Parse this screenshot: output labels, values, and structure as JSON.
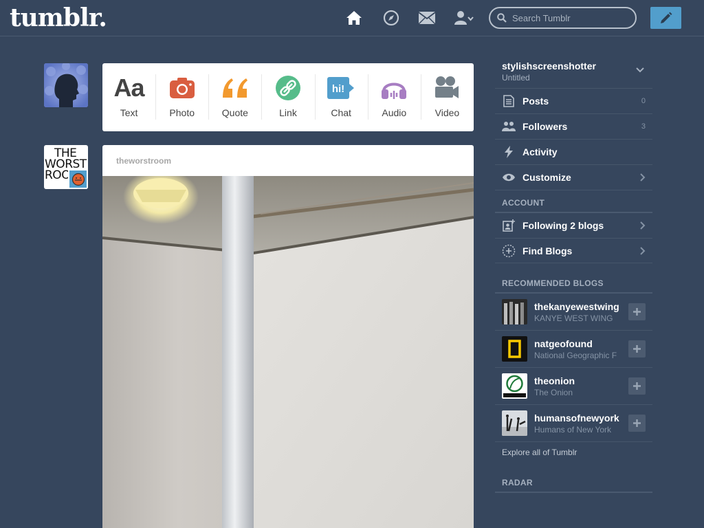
{
  "header": {
    "logo": "tumblr.",
    "search_placeholder": "Search Tumblr",
    "colors": {
      "background": "#36465d",
      "accent": "#529ecc"
    },
    "icons": [
      "home-icon",
      "explore-icon",
      "inbox-icon",
      "account-icon",
      "compose-icon"
    ]
  },
  "post_types": [
    {
      "label": "Text",
      "icon": "text-icon",
      "color": "#444444"
    },
    {
      "label": "Photo",
      "icon": "camera-icon",
      "color": "#d95e40"
    },
    {
      "label": "Quote",
      "icon": "quote-icon",
      "color": "#f2992e"
    },
    {
      "label": "Link",
      "icon": "link-icon",
      "color": "#56bc8a"
    },
    {
      "label": "Chat",
      "icon": "chat-icon",
      "color": "#529ecc"
    },
    {
      "label": "Audio",
      "icon": "headphones-icon",
      "color": "#a77dc2"
    },
    {
      "label": "Video",
      "icon": "video-camera-icon",
      "color": "#748089"
    }
  ],
  "post": {
    "author": "theworstroom",
    "avatar_text": [
      "THE",
      "WORST",
      "ROO"
    ]
  },
  "sidebar": {
    "blog": {
      "name": "stylishscreenshotter",
      "subtitle": "Untitled"
    },
    "menu": [
      {
        "label": "Posts",
        "count": "0",
        "icon": "posts-icon"
      },
      {
        "label": "Followers",
        "count": "3",
        "icon": "followers-icon"
      },
      {
        "label": "Activity",
        "count": "",
        "icon": "activity-icon"
      },
      {
        "label": "Customize",
        "count": "",
        "icon": "eye-icon"
      }
    ],
    "account_title": "ACCOUNT",
    "account_items": [
      {
        "label": "Following 2 blogs",
        "icon": "following-icon"
      },
      {
        "label": "Find Blogs",
        "icon": "find-blogs-icon"
      }
    ],
    "recommended_title": "RECOMMENDED BLOGS",
    "recommended": [
      {
        "name": "thekanyewestwing",
        "title": "KANYE WEST WING"
      },
      {
        "name": "natgeofound",
        "title": "National Geographic F"
      },
      {
        "name": "theonion",
        "title": "The Onion"
      },
      {
        "name": "humansofnewyork",
        "title": "Humans of New York"
      }
    ],
    "explore_link": "Explore all of Tumblr",
    "radar_title": "RADAR"
  }
}
